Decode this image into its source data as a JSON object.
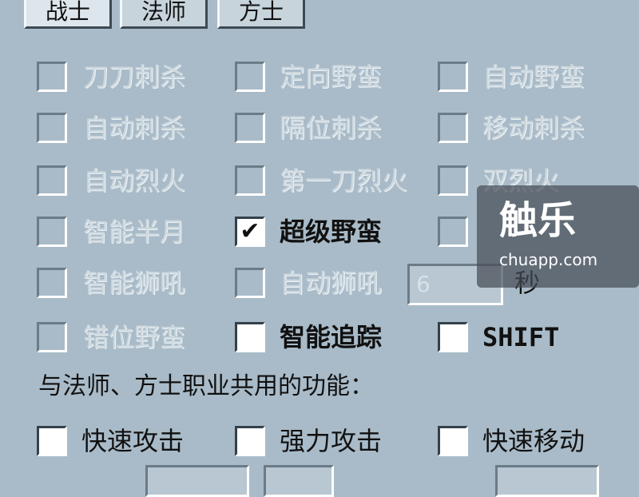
{
  "tabs": [
    {
      "label": "战士",
      "active": true
    },
    {
      "label": "法师",
      "active": false
    },
    {
      "label": "方士",
      "active": false
    }
  ],
  "options": {
    "r1": [
      {
        "label": "刀刀刺杀",
        "checked": false,
        "enabled": false
      },
      {
        "label": "定向野蛮",
        "checked": false,
        "enabled": false
      },
      {
        "label": "自动野蛮",
        "checked": false,
        "enabled": false
      }
    ],
    "r2": [
      {
        "label": "自动刺杀",
        "checked": false,
        "enabled": false
      },
      {
        "label": "隔位刺杀",
        "checked": false,
        "enabled": false
      },
      {
        "label": "移动刺杀",
        "checked": false,
        "enabled": false
      }
    ],
    "r3": [
      {
        "label": "自动烈火",
        "checked": false,
        "enabled": false
      },
      {
        "label": "第一刀烈火",
        "checked": false,
        "enabled": false
      },
      {
        "label": "双烈火",
        "checked": false,
        "enabled": false
      }
    ],
    "r4": [
      {
        "label": "智能半月",
        "checked": false,
        "enabled": false
      },
      {
        "label": "超级野蛮",
        "checked": true,
        "check_mark": "✔",
        "enabled": true
      },
      {
        "label": "",
        "checked": false,
        "enabled": false
      }
    ],
    "r5": [
      {
        "label": "智能狮吼",
        "checked": false,
        "enabled": false
      },
      {
        "label": "自动狮吼",
        "checked": false,
        "enabled": false
      }
    ],
    "r6": [
      {
        "label": "错位野蛮",
        "checked": false,
        "enabled": false
      },
      {
        "label": "智能追踪",
        "checked": false,
        "enabled": true
      },
      {
        "label": "SHIFT",
        "checked": false,
        "enabled": true
      }
    ],
    "roar_interval": {
      "value": "6",
      "unit": "秒"
    }
  },
  "shared": {
    "title": "与法师、方士职业共用的功能：",
    "items": [
      {
        "label": "快速攻击",
        "checked": false,
        "enabled": true
      },
      {
        "label": "强力攻击",
        "checked": false,
        "enabled": true
      },
      {
        "label": "快速移动",
        "checked": false,
        "enabled": true
      }
    ]
  },
  "watermark": {
    "logo": "触乐",
    "url": "chuapp.com"
  }
}
